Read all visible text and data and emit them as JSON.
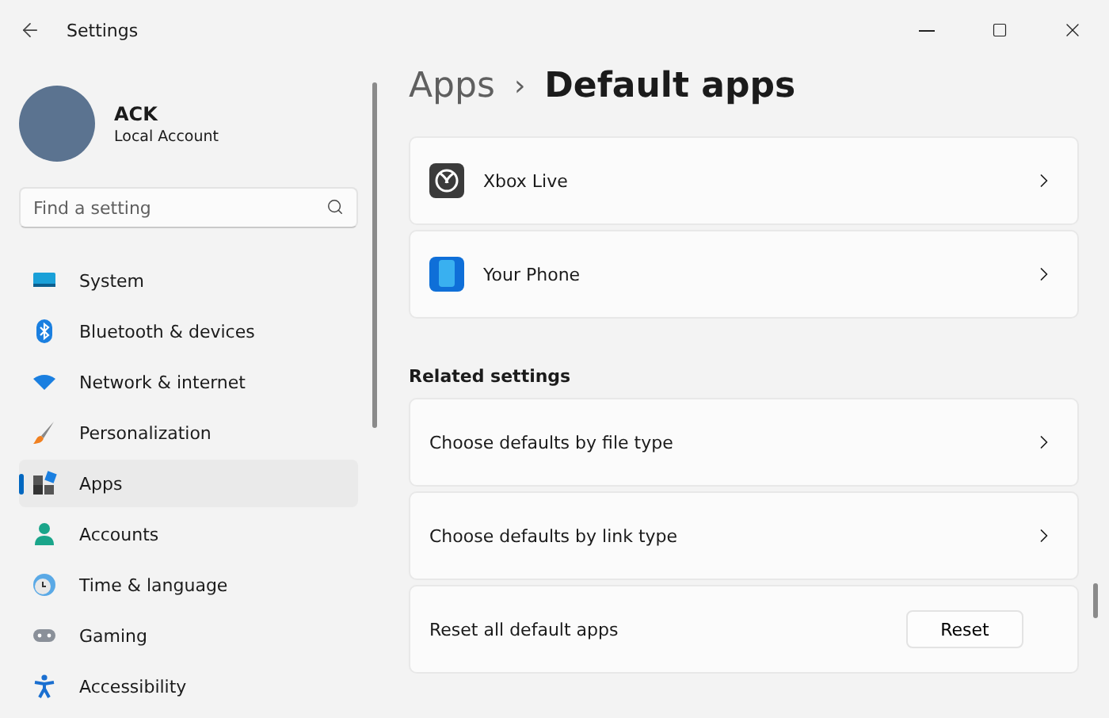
{
  "window": {
    "title": "Settings"
  },
  "account": {
    "name": "ACK",
    "type": "Local Account"
  },
  "search": {
    "placeholder": "Find a setting"
  },
  "nav": [
    {
      "label": "System",
      "selected": false
    },
    {
      "label": "Bluetooth & devices",
      "selected": false
    },
    {
      "label": "Network & internet",
      "selected": false
    },
    {
      "label": "Personalization",
      "selected": false
    },
    {
      "label": "Apps",
      "selected": true
    },
    {
      "label": "Accounts",
      "selected": false
    },
    {
      "label": "Time & language",
      "selected": false
    },
    {
      "label": "Gaming",
      "selected": false
    },
    {
      "label": "Accessibility",
      "selected": false
    }
  ],
  "breadcrumb": {
    "parent": "Apps",
    "separator": "›",
    "current": "Default apps"
  },
  "apps": [
    {
      "name": "Xbox Live"
    },
    {
      "name": "Your Phone"
    }
  ],
  "related_settings": {
    "title": "Related settings",
    "items": [
      {
        "kind": "link",
        "label": "Choose defaults by file type"
      },
      {
        "kind": "link",
        "label": "Choose defaults by link type"
      },
      {
        "kind": "button",
        "label": "Reset all default apps",
        "button": "Reset"
      }
    ]
  }
}
